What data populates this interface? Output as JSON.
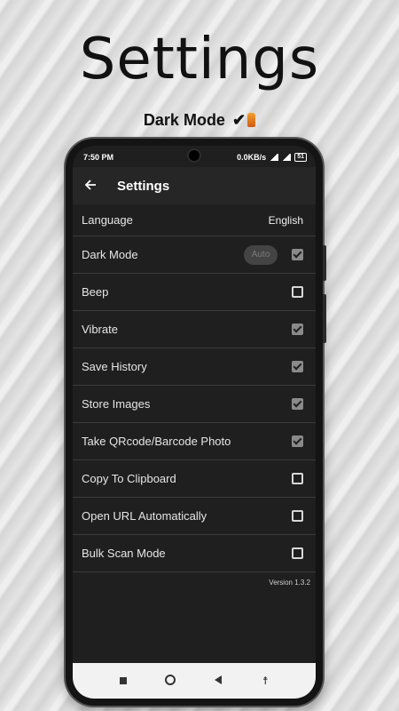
{
  "promo": {
    "title": "Settings",
    "subtitle": "Dark Mode",
    "check_glyph": "✔"
  },
  "status_bar": {
    "time": "7:50 PM",
    "speed": "0.0KB/s",
    "battery": "51"
  },
  "app_bar": {
    "back_icon": "arrow-left-icon",
    "title": "Settings"
  },
  "settings": {
    "language": {
      "label": "Language",
      "value": "English"
    },
    "dark_mode": {
      "label": "Dark Mode",
      "auto_label": "Auto",
      "checked": true
    },
    "items": [
      {
        "label": "Beep",
        "checked": false
      },
      {
        "label": "Vibrate",
        "checked": true
      },
      {
        "label": "Save History",
        "checked": true
      },
      {
        "label": "Store Images",
        "checked": true
      },
      {
        "label": "Take QRcode/Barcode Photo",
        "checked": true
      },
      {
        "label": "Copy To Clipboard",
        "checked": false
      },
      {
        "label": "Open URL Automatically",
        "checked": false
      },
      {
        "label": "Bulk Scan Mode",
        "checked": false
      }
    ]
  },
  "version": "Version 1.3.2",
  "nav_bar": {
    "icons": [
      "recents-icon",
      "home-icon",
      "back-icon",
      "accessibility-icon"
    ],
    "accessibility_glyph": "☨"
  },
  "colors": {
    "screen_bg": "#1f1f1f",
    "checkbox_on": "#8a8a8a",
    "divider": "#3b3b3b"
  }
}
